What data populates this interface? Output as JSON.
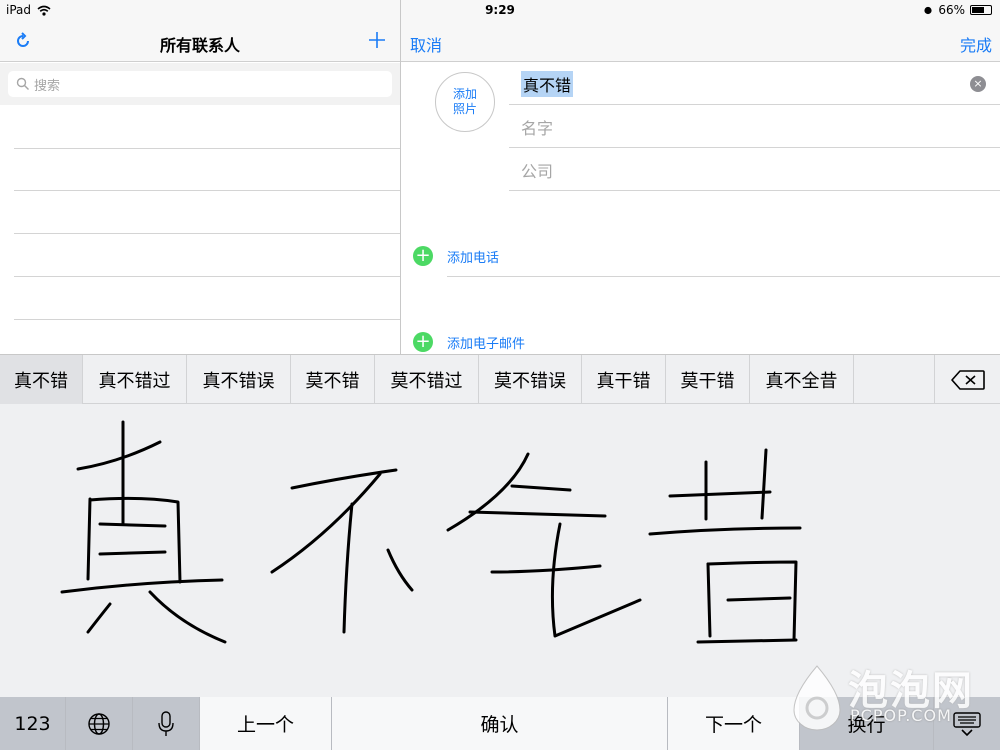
{
  "status_bar": {
    "device": "iPad",
    "time": "9:29",
    "battery": "66%",
    "battery_level": 0.66
  },
  "left_panel": {
    "title": "所有联系人",
    "search_placeholder": "搜索"
  },
  "right_panel": {
    "cancel": "取消",
    "done": "完成",
    "add_photo_line1": "添加",
    "add_photo_line2": "照片",
    "field_last_name": "真不错",
    "field_first_name_placeholder": "名字",
    "field_company_placeholder": "公司",
    "add_phone": "添加电话",
    "add_email": "添加电子邮件"
  },
  "candidates": [
    "真不错",
    "真不错过",
    "真不错误",
    "莫不错",
    "莫不错过",
    "莫不错误",
    "真干错",
    "莫干错",
    "真不全昔"
  ],
  "keyboard": {
    "numbers_key": "123",
    "previous_key": "上一个",
    "confirm_key": "确认",
    "next_key": "下一个",
    "return_key": "换行"
  },
  "watermark": {
    "text": "泡泡网",
    "sub": "PCPOP.COM"
  },
  "colors": {
    "accent": "#1a7cf6",
    "green": "#4cd964",
    "highlight": "#b5d4f5"
  }
}
